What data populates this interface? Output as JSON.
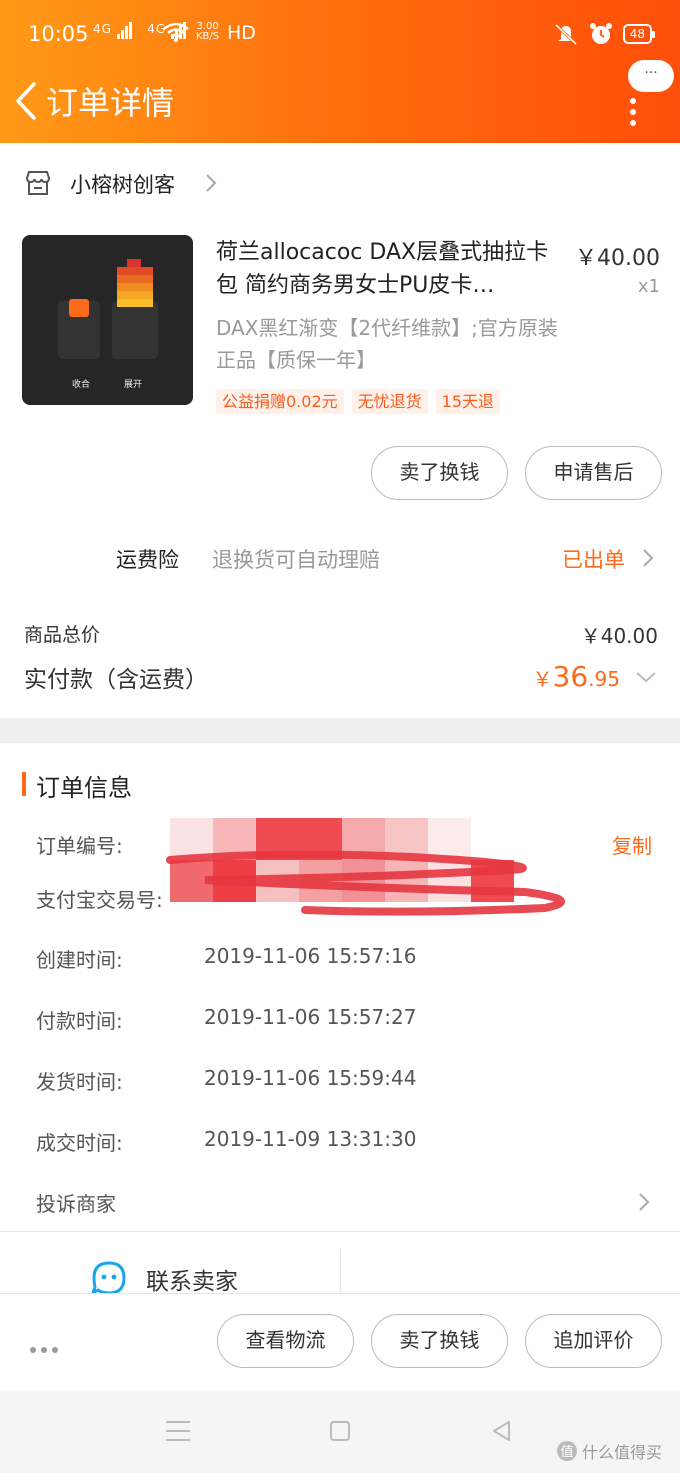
{
  "status_bar": {
    "time": "10:05",
    "signal_1": "4G",
    "signal_2": "4G",
    "speed_value": "3.00",
    "speed_unit": "KB/S",
    "hd": "HD",
    "battery": "48"
  },
  "header": {
    "title": "订单详情",
    "more_label": "···"
  },
  "shop": {
    "name": "小榕树创客"
  },
  "product": {
    "title": "荷兰allocacoc DAX层叠式抽拉卡包 简约商务男女士PU皮卡…",
    "price": "￥40.00",
    "qty": "x1",
    "sku": "DAX黑红渐变【2代纤维款】;官方原装正品【质保一年】",
    "thumb_label_left": "收合",
    "thumb_label_right": "展开",
    "tags": [
      "公益捐赠0.02元",
      "无忧退货",
      "15天退"
    ],
    "buttons": {
      "sell": "卖了换钱",
      "after_sale": "申请售后"
    }
  },
  "insurance": {
    "label": "运费险",
    "desc": "退换货可自动理赔",
    "status": "已出单"
  },
  "totals": {
    "goods_label": "商品总价",
    "goods_value": "￥40.00",
    "paid_label": "实付款（含运费）",
    "paid_currency": "￥",
    "paid_int": "36",
    "paid_dec": ".95"
  },
  "order_info": {
    "title": "订单信息",
    "order_no_label": "订单编号:",
    "alipay_no_label": "支付宝交易号:",
    "copy_label": "复制",
    "created_label": "创建时间:",
    "created_value": "2019-11-06 15:57:16",
    "paid_label": "付款时间:",
    "paid_value": "2019-11-06 15:57:27",
    "shipped_label": "发货时间:",
    "shipped_value": "2019-11-06 15:59:44",
    "deal_label": "成交时间:",
    "deal_value": "2019-11-09 13:31:30",
    "complain_label": "投诉商家"
  },
  "contact": {
    "label": "联系卖家"
  },
  "bottom_bar": {
    "logistics": "查看物流",
    "sell": "卖了换钱",
    "review": "追加评价"
  },
  "watermark": {
    "text": "什么值得买"
  },
  "colors": {
    "accent": "#ff6a1a",
    "header_start": "#ff9a17",
    "header_end": "#ff4e0a"
  }
}
